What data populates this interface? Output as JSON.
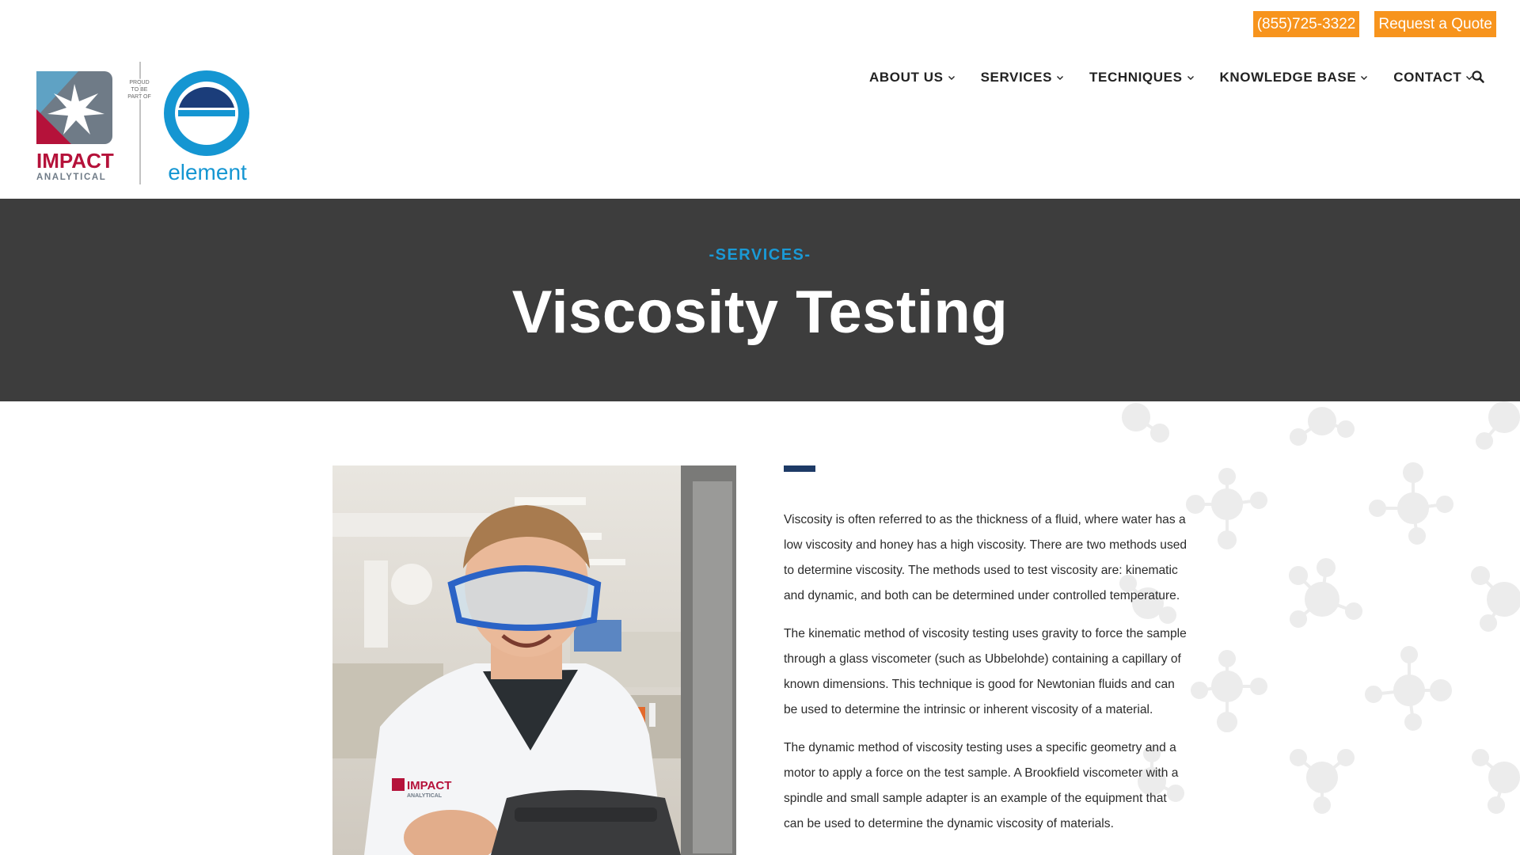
{
  "topbar": {
    "phone": "(855)725-3322",
    "quote": "Request a Quote"
  },
  "logo": {
    "brand": "IMPACT",
    "brand_sub": "ANALYTICAL",
    "proud_line1": "PROUD",
    "proud_line2": "TO BE",
    "proud_line3": "PART OF",
    "partner": "element"
  },
  "nav": {
    "items": [
      {
        "label": "ABOUT US"
      },
      {
        "label": "SERVICES"
      },
      {
        "label": "TECHNIQUES"
      },
      {
        "label": "KNOWLEDGE BASE"
      },
      {
        "label": "CONTACT"
      }
    ]
  },
  "hero": {
    "eyebrow": "-SERVICES-",
    "title": "Viscosity Testing"
  },
  "photo": {
    "coat_logo": "IMPACT",
    "coat_logo_sub": "ANALYTICAL"
  },
  "content": {
    "paragraphs": [
      "Viscosity is often referred to as the thickness of a fluid, where water has a low viscosity and honey has a high viscosity. There are two methods used to determine viscosity.  The methods used to test viscosity are: kinematic and dynamic, and both can be determined under controlled temperature.",
      "The kinematic method of viscosity testing uses gravity to force the sample through a glass viscometer (such as Ubbelohde) containing a capillary of known dimensions. This technique is good for Newtonian fluids and can be used to determine the intrinsic or inherent viscosity of a material.",
      "The dynamic method of viscosity testing uses a specific geometry and a motor to apply a force on the test sample. A Brookfield viscometer with a spindle and small sample adapter is an example of the equipment that can be used to determine the dynamic viscosity of materials."
    ]
  },
  "colors": {
    "accent_orange": "#f7941d",
    "hero_bg": "#3d3d3d",
    "eyebrow_blue": "#1a9ad6",
    "navy": "#1d3a66",
    "impact_red": "#b5123a",
    "element_blue": "#1596d2"
  },
  "icons": {
    "search": "search-icon",
    "chevron": "chevron-down-icon"
  }
}
